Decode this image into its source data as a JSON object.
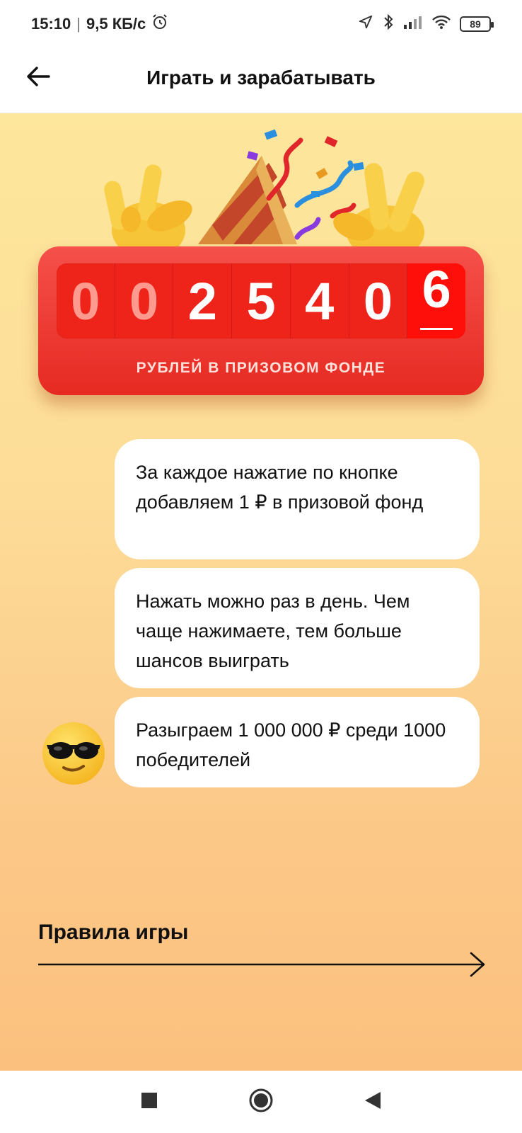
{
  "status_bar": {
    "time": "15:10",
    "speed": "9,5 КБ/с",
    "battery": "89",
    "icons": [
      "alarm-icon",
      "location-icon",
      "bluetooth-icon",
      "signal-icon",
      "wifi-icon",
      "battery-icon"
    ]
  },
  "header": {
    "title": "Играть и зарабатывать",
    "back_icon": "arrow-left-icon"
  },
  "counter": {
    "digits": [
      "0",
      "0",
      "2",
      "5",
      "4",
      "0",
      "6"
    ],
    "caption": "РУБЛЕЙ В ПРИЗОВОМ ФОНДЕ",
    "colors": {
      "card": "#e62a22",
      "dim_digit": "#ff9a8e"
    }
  },
  "messages": [
    {
      "text": "За каждое нажатие по кнопке добавляем 1 ₽ в призовой фонд"
    },
    {
      "text": "Нажать можно раз в день. Чем чаще нажимаете, тем больше шансов выиграть"
    },
    {
      "text": "Разыграем 1 000 000 ₽ среди 1000 победителей"
    }
  ],
  "avatar": {
    "icon": "sunglasses-emoji-icon"
  },
  "rules": {
    "label": "Правила игры",
    "icon": "arrow-right-icon"
  },
  "nav": {
    "icons": [
      "recents-square-icon",
      "home-circle-icon",
      "back-triangle-icon"
    ]
  },
  "colors": {
    "bg_top": "#fde79c",
    "bg_bottom": "#fbc07e",
    "accent_red": "#ee241b"
  }
}
